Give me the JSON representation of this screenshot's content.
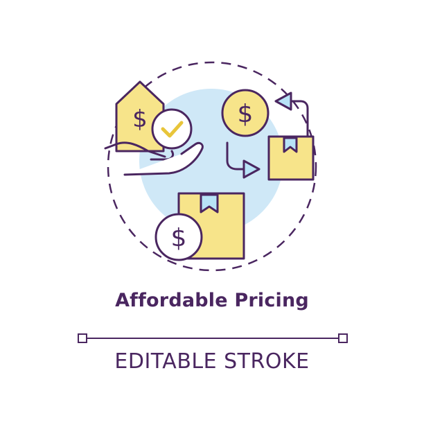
{
  "title": "Affordable Pricing",
  "caption": "EDITABLE STROKE",
  "icon": {
    "name": "affordable-pricing-concept-icon",
    "currency_symbol": "$"
  },
  "colors": {
    "stroke": "#4a2660",
    "fill_yellow": "#f7e48a",
    "fill_blue": "#cfe8f7",
    "arrow_blue": "#b8e3f7",
    "background": "#ffffff"
  }
}
